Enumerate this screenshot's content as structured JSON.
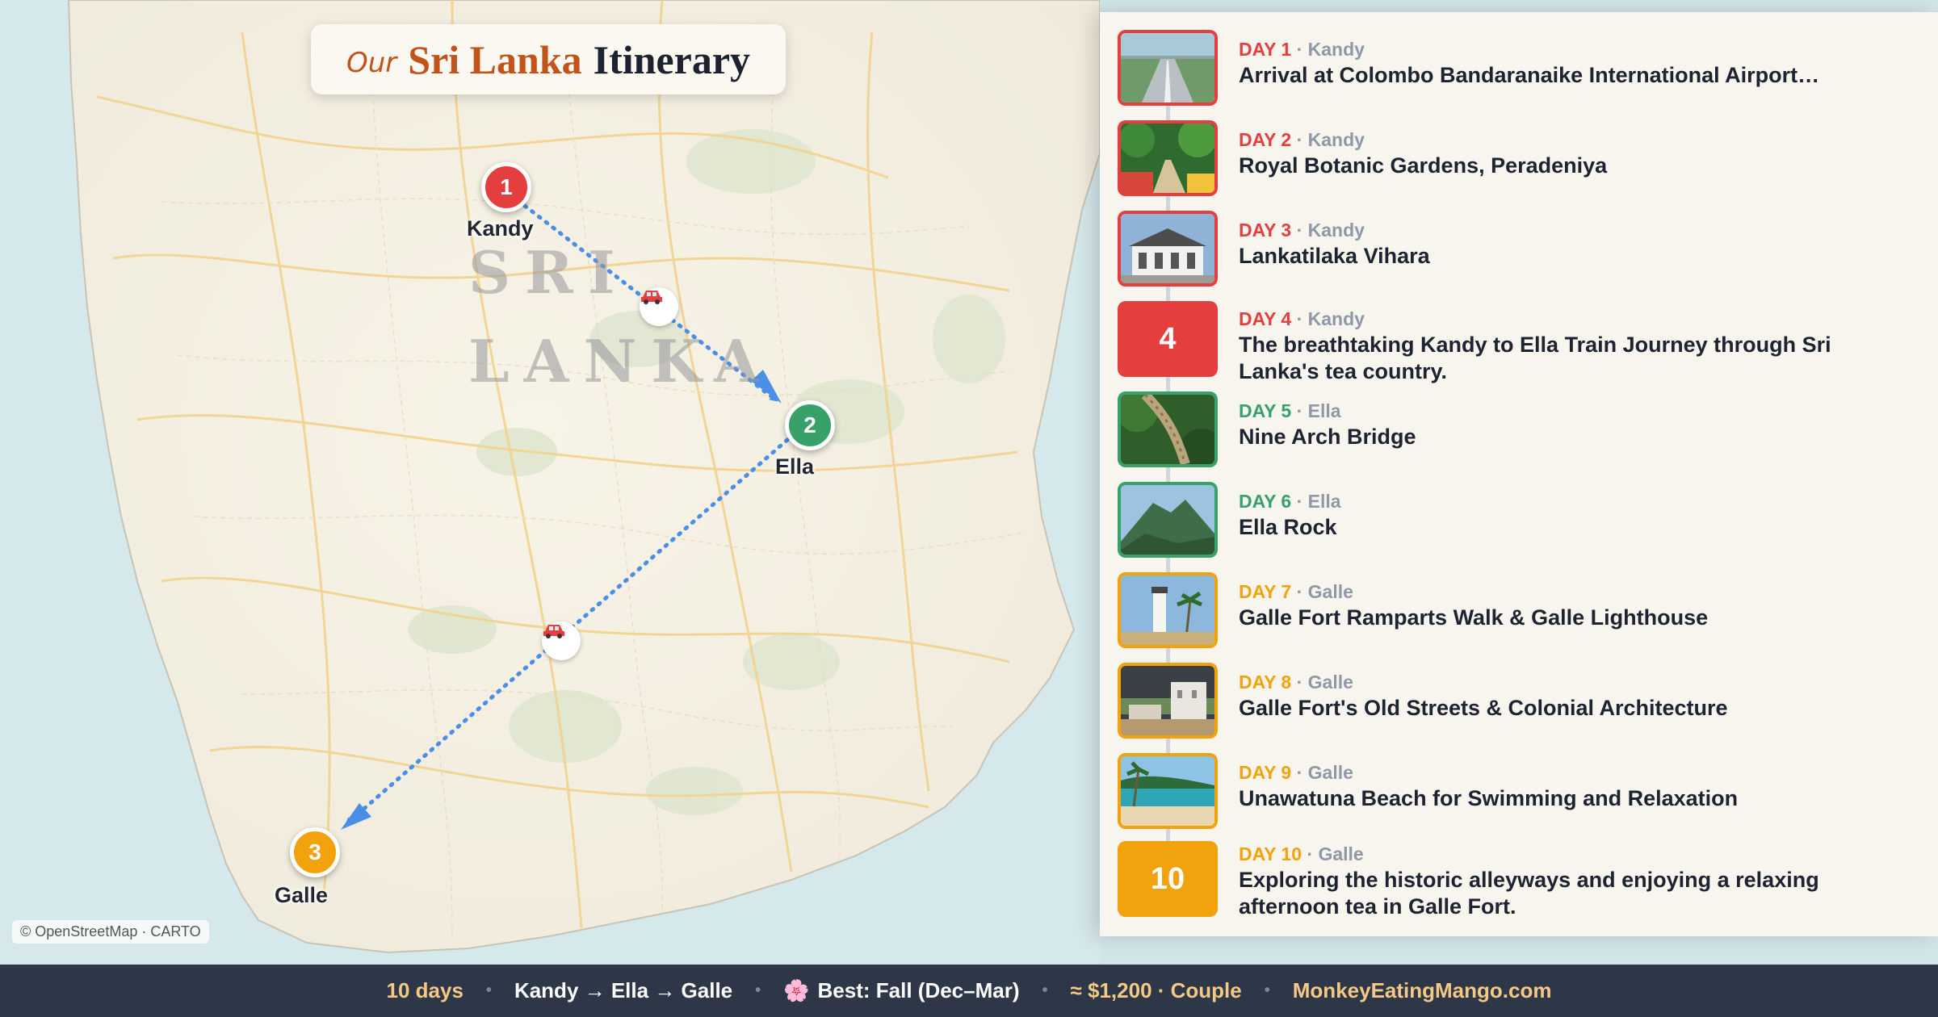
{
  "title": {
    "our": "Our",
    "place": "Sri Lanka",
    "rest": "Itinerary"
  },
  "map": {
    "country_label_line1": "SRI",
    "country_label_line2": "LANKA",
    "attribution": "© OpenStreetMap · CARTO",
    "route_icon": "car-icon",
    "stops": [
      {
        "number": "1",
        "name": "Kandy",
        "color": "#e53e3e"
      },
      {
        "number": "2",
        "name": "Ella",
        "color": "#38a169"
      },
      {
        "number": "3",
        "name": "Galle",
        "color": "#f2a20c"
      }
    ]
  },
  "days": [
    {
      "day_label": "DAY 1",
      "city": "· Kandy",
      "title": "Arrival at Colombo Bandaranaike International Airport…",
      "color": "#e53e3e",
      "thumb": "airport-runway-photo"
    },
    {
      "day_label": "DAY 2",
      "city": "· Kandy",
      "title": "Royal Botanic Gardens, Peradeniya",
      "color": "#e53e3e",
      "thumb": "botanic-garden-photo"
    },
    {
      "day_label": "DAY 3",
      "city": "· Kandy",
      "title": "Lankatilaka Vihara",
      "color": "#e53e3e",
      "thumb": "temple-photo"
    },
    {
      "day_label": "DAY 4",
      "city": "· Kandy",
      "title": "The breathtaking Kandy to Ella Train Journey through Sri Lanka's tea country.",
      "color": "#e53e3e",
      "tile_number": "4"
    },
    {
      "day_label": "DAY 5",
      "city": "· Ella",
      "title": "Nine Arch Bridge",
      "color": "#38a169",
      "thumb": "bridge-photo"
    },
    {
      "day_label": "DAY 6",
      "city": "· Ella",
      "title": "Ella Rock",
      "color": "#38a169",
      "thumb": "mountain-photo"
    },
    {
      "day_label": "DAY 7",
      "city": "· Galle",
      "title": "Galle Fort Ramparts Walk & Galle Lighthouse",
      "color": "#f2a20c",
      "thumb": "lighthouse-photo"
    },
    {
      "day_label": "DAY 8",
      "city": "· Galle",
      "title": "Galle Fort's Old Streets & Colonial Architecture",
      "color": "#f2a20c",
      "thumb": "colonial-street-photo"
    },
    {
      "day_label": "DAY 9",
      "city": "· Galle",
      "title": "Unawatuna Beach for Swimming and Relaxation",
      "color": "#f2a20c",
      "thumb": "beach-photo"
    },
    {
      "day_label": "DAY 10",
      "city": "· Galle",
      "title": "Exploring the historic alleyways and enjoying a relaxing afternoon tea in Galle Fort.",
      "color": "#f2a20c",
      "tile_number": "10"
    }
  ],
  "footer": {
    "duration": "10 days",
    "route": "Kandy → Ella → Galle",
    "season_icon": "🌸",
    "season": "Best: Fall (Dec–Mar)",
    "budget": "≈ $1,200 · Couple",
    "site": "MonkeyEatingMango.com",
    "separator": "•"
  }
}
